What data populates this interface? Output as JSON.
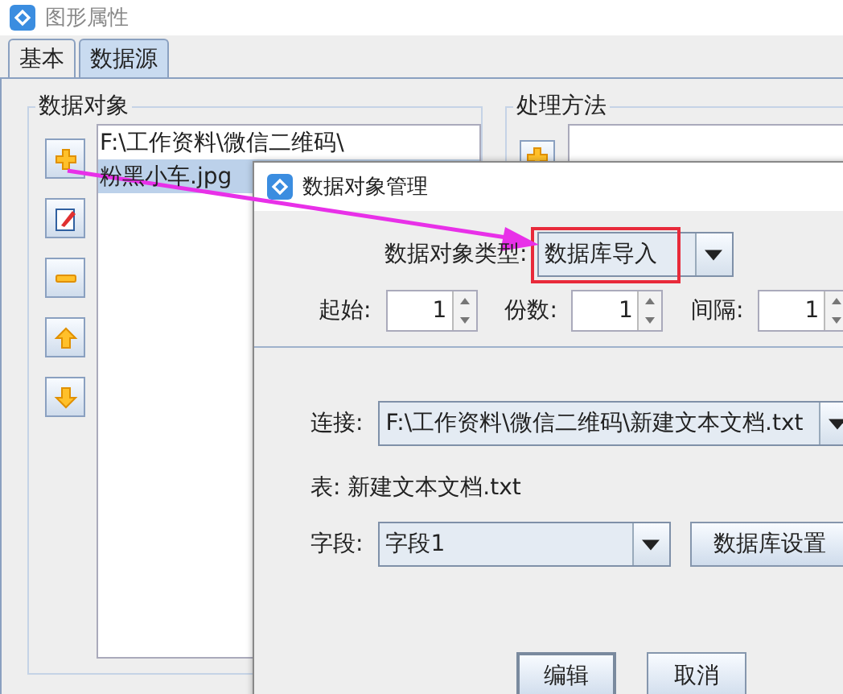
{
  "window": {
    "title": "图形属性"
  },
  "tabs": [
    {
      "label": "基本",
      "selected": false
    },
    {
      "label": "数据源",
      "selected": true
    }
  ],
  "data_objects": {
    "title": "数据对象",
    "items": [
      {
        "label": "F:\\工作资料\\微信二维码\\",
        "selected": false
      },
      {
        "label": "粉黑小车.jpg",
        "selected": true
      }
    ]
  },
  "processing": {
    "title": "处理方法"
  },
  "dialog": {
    "title": "数据对象管理",
    "type_label": "数据对象类型:",
    "type_value": "数据库导入",
    "spinners": [
      {
        "label": "起始:",
        "value": "1"
      },
      {
        "label": "份数:",
        "value": "1"
      },
      {
        "label": "间隔:",
        "value": "1"
      }
    ],
    "connection_label": "连接:",
    "connection_value": "F:\\工作资料\\微信二维码\\新建文本文档.txt",
    "table_text": "表: 新建文本文档.txt",
    "field_label": "字段:",
    "field_value": "字段1",
    "settings_button": "数据库设置",
    "buttons": [
      {
        "label": "编辑",
        "focused": true
      },
      {
        "label": "取消",
        "focused": false
      }
    ]
  }
}
